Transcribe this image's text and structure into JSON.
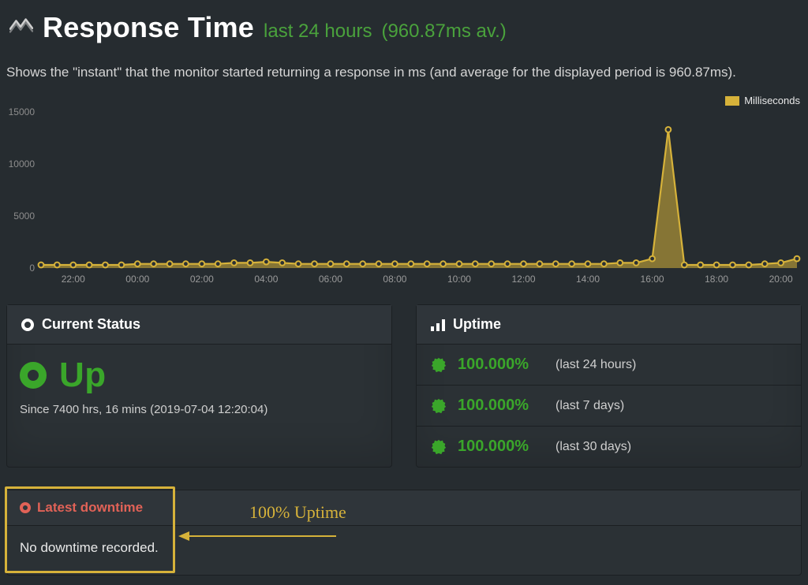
{
  "header": {
    "title": "Response Time",
    "range": "last 24 hours",
    "avg": "(960.87ms av.)"
  },
  "description": "Shows the \"instant\" that the monitor started returning a response in ms (and average for the displayed period is 960.87ms).",
  "legend": {
    "label": "Milliseconds"
  },
  "y_ticks": [
    "0",
    "5000",
    "10000",
    "15000"
  ],
  "x_ticks": [
    "22:00",
    "00:00",
    "02:00",
    "04:00",
    "06:00",
    "08:00",
    "10:00",
    "12:00",
    "14:00",
    "16:00",
    "18:00",
    "20:00"
  ],
  "status_card": {
    "title": "Current Status",
    "state": "Up",
    "since": "Since 7400 hrs, 16 mins (2019-07-04 12:20:04)"
  },
  "uptime_card": {
    "title": "Uptime",
    "rows": [
      {
        "pct": "100.000%",
        "label": "(last 24 hours)"
      },
      {
        "pct": "100.000%",
        "label": "(last 7 days)"
      },
      {
        "pct": "100.000%",
        "label": "(last 30 days)"
      }
    ]
  },
  "downtime_card": {
    "title": "Latest downtime",
    "body": "No downtime recorded."
  },
  "annotation": "100% Uptime",
  "chart_data": {
    "type": "area",
    "title": "Response Time",
    "xlabel": "",
    "ylabel": "Milliseconds",
    "ylim": [
      0,
      15000
    ],
    "x": [
      "21:00",
      "21:30",
      "22:00",
      "22:30",
      "23:00",
      "23:30",
      "00:00",
      "00:30",
      "01:00",
      "01:30",
      "02:00",
      "02:30",
      "03:00",
      "03:30",
      "04:00",
      "04:30",
      "05:00",
      "05:30",
      "06:00",
      "06:30",
      "07:00",
      "07:30",
      "08:00",
      "08:30",
      "09:00",
      "09:30",
      "10:00",
      "10:30",
      "11:00",
      "11:30",
      "12:00",
      "12:30",
      "13:00",
      "13:30",
      "14:00",
      "14:30",
      "15:00",
      "15:30",
      "16:00",
      "16:30",
      "17:00",
      "17:30",
      "18:00",
      "18:30",
      "19:00",
      "19:30",
      "20:00",
      "20:30"
    ],
    "series": [
      {
        "name": "Milliseconds",
        "values": [
          300,
          300,
          300,
          300,
          300,
          300,
          400,
          400,
          400,
          400,
          400,
          400,
          500,
          500,
          600,
          500,
          400,
          400,
          400,
          400,
          400,
          400,
          400,
          400,
          400,
          400,
          400,
          400,
          400,
          400,
          400,
          400,
          400,
          400,
          400,
          400,
          500,
          500,
          900,
          13300,
          300,
          300,
          300,
          300,
          300,
          400,
          500,
          900
        ]
      }
    ],
    "x_ticks": [
      "22:00",
      "00:00",
      "02:00",
      "04:00",
      "06:00",
      "08:00",
      "10:00",
      "12:00",
      "14:00",
      "16:00",
      "18:00",
      "20:00"
    ],
    "legend_position": "top-right",
    "grid": false
  }
}
